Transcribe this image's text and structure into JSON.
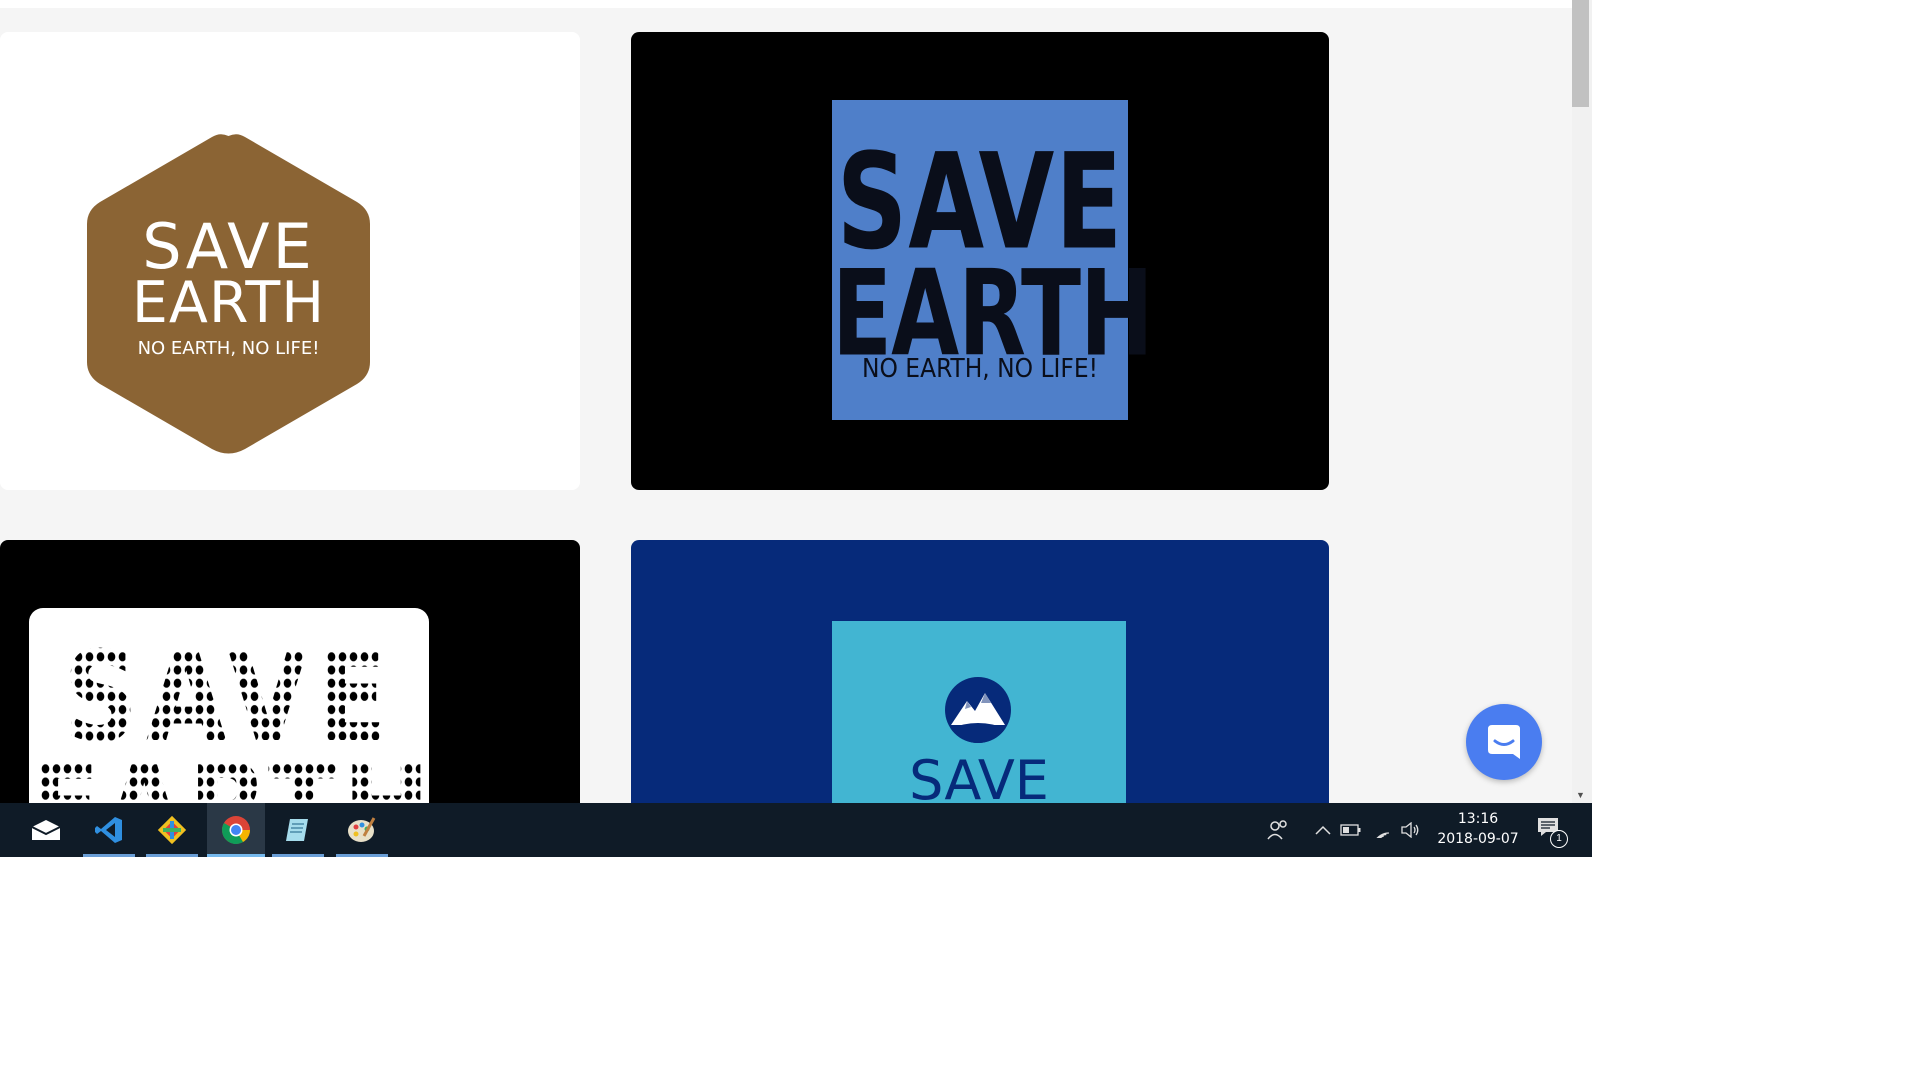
{
  "cards": {
    "hexagon": {
      "line1": "SAVE",
      "line2": "EARTH",
      "tagline": "NO EARTH, NO LIFE!",
      "color": "#8b6434"
    },
    "blue_poster": {
      "line1": "SAVE",
      "line2": "EARTH",
      "tagline": "NO EARTH, NO LIFE!",
      "color": "#4f7fc9"
    },
    "dotted": {
      "line1": "SAVE",
      "line2": "EARTH"
    },
    "cyan_poster": {
      "text": "SAVE",
      "color": "#42b5d2"
    }
  },
  "chat_button": {
    "icon": "chat-bubble-icon",
    "color": "#4a7df0"
  },
  "taskbar": {
    "apps": [
      {
        "icon": "mail-icon",
        "state": "pinned"
      },
      {
        "icon": "vscode-icon",
        "state": "running"
      },
      {
        "icon": "git-tool-icon",
        "state": "running"
      },
      {
        "icon": "chrome-icon",
        "state": "active"
      },
      {
        "icon": "notepad-icon",
        "state": "running"
      },
      {
        "icon": "paint-icon",
        "state": "running"
      }
    ],
    "tray": {
      "icons": [
        "people-icon",
        "chevron-up-icon",
        "battery-icon",
        "wifi-icon",
        "volume-icon"
      ],
      "time": "13:16",
      "date": "2018-09-07",
      "notification_count": "1"
    }
  }
}
